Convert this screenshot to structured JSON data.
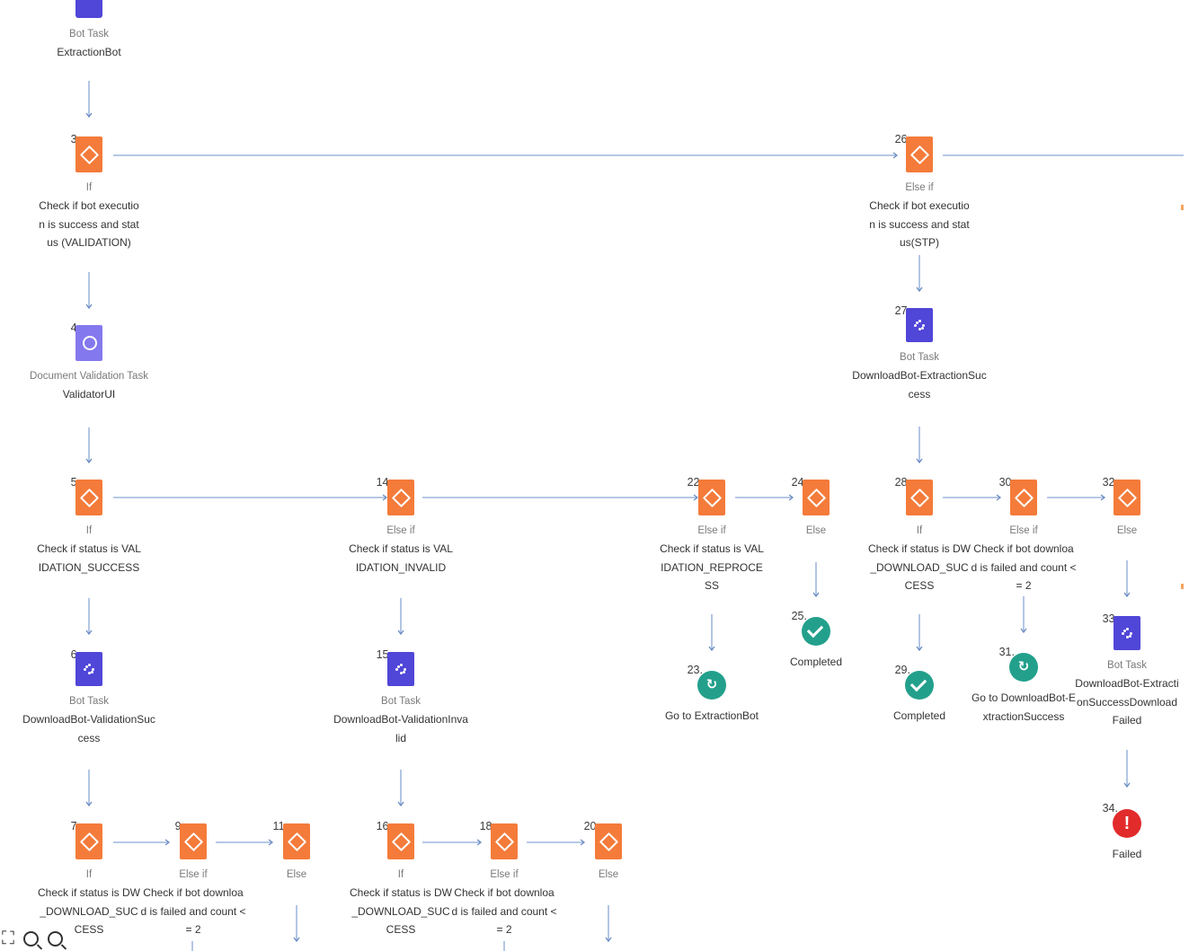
{
  "top_partial": {
    "title": "Bot Task",
    "desc": "ExtractionBot"
  },
  "nodes": {
    "n3": {
      "num": "3.",
      "title": "If",
      "desc": "Check if bot execution is success and status (VALIDATION)",
      "icon": "condition-icon"
    },
    "n4": {
      "num": "4.",
      "title": "Document Validation Task",
      "desc": "ValidatorUI",
      "icon": "validation-icon"
    },
    "n5": {
      "num": "5.",
      "title": "If",
      "desc": "Check if status is VALIDATION_SUCCESS",
      "icon": "condition-icon"
    },
    "n6": {
      "num": "6.",
      "title": "Bot Task",
      "desc": "DownloadBot-ValidationSuccess",
      "icon": "bot-icon"
    },
    "n7": {
      "num": "7.",
      "title": "If",
      "desc": "Check if status is DW_DOWNLOAD_SUCCESS",
      "icon": "condition-icon"
    },
    "n9": {
      "num": "9.",
      "title": "Else if",
      "desc": "Check if bot download is failed and count <= 2",
      "icon": "condition-icon"
    },
    "n11": {
      "num": "11.",
      "title": "Else",
      "desc": "",
      "icon": "condition-icon"
    },
    "n14": {
      "num": "14.",
      "title": "Else if",
      "desc": "Check if status is VALIDATION_INVALID",
      "icon": "condition-icon"
    },
    "n15": {
      "num": "15.",
      "title": "Bot Task",
      "desc": "DownloadBot-ValidationInvalid",
      "icon": "bot-icon"
    },
    "n16": {
      "num": "16.",
      "title": "If",
      "desc": "Check if status is DW_DOWNLOAD_SUCCESS",
      "icon": "condition-icon"
    },
    "n18": {
      "num": "18.",
      "title": "Else if",
      "desc": "Check if bot download is failed and count <= 2",
      "icon": "condition-icon"
    },
    "n20": {
      "num": "20.",
      "title": "Else",
      "desc": "",
      "icon": "condition-icon"
    },
    "n22": {
      "num": "22.",
      "title": "Else if",
      "desc": "Check if status is VALIDATION_REPROCESS",
      "icon": "condition-icon"
    },
    "n23": {
      "num": "23.",
      "title": "",
      "desc": "Go to ExtractionBot",
      "icon": "goto-icon",
      "glyph": "↻"
    },
    "n24": {
      "num": "24.",
      "title": "Else",
      "desc": "",
      "icon": "condition-icon"
    },
    "n25": {
      "num": "25.",
      "title": "",
      "desc": "Completed",
      "icon": "check-icon"
    },
    "n26": {
      "num": "26.",
      "title": "Else if",
      "desc": "Check if bot execution is success and status(STP)",
      "icon": "condition-icon"
    },
    "n27": {
      "num": "27.",
      "title": "Bot Task",
      "desc": "DownloadBot-ExtractionSuccess",
      "icon": "bot-icon"
    },
    "n28": {
      "num": "28.",
      "title": "If",
      "desc": "Check if status is DW_DOWNLOAD_SUCCESS",
      "icon": "condition-icon"
    },
    "n29": {
      "num": "29.",
      "title": "",
      "desc": "Completed",
      "icon": "check-icon"
    },
    "n30": {
      "num": "30.",
      "title": "Else if",
      "desc": "Check if bot download is failed and count <= 2",
      "icon": "condition-icon"
    },
    "n31": {
      "num": "31.",
      "title": "",
      "desc": "Go to DownloadBot-ExtractionSuccess",
      "icon": "goto-icon",
      "glyph": "↻"
    },
    "n32": {
      "num": "32.",
      "title": "Else",
      "desc": "",
      "icon": "condition-icon"
    },
    "n33": {
      "num": "33.",
      "title": "Bot Task",
      "desc": "DownloadBot-ExtractionSuccessDownloadFailed",
      "icon": "bot-icon"
    },
    "n34": {
      "num": "34.",
      "title": "",
      "desc": "Failed",
      "icon": "failed-icon",
      "glyph": "!"
    }
  },
  "zoom_controls": {
    "fit": "⛶",
    "zoom_out": "−",
    "zoom_in": "+"
  },
  "colors": {
    "condition": "#f47b3a",
    "bot": "#5046d8",
    "validation": "#8478ee",
    "success": "#23a08c",
    "failed": "#e22b2b",
    "connector": "#6b8cc4"
  }
}
